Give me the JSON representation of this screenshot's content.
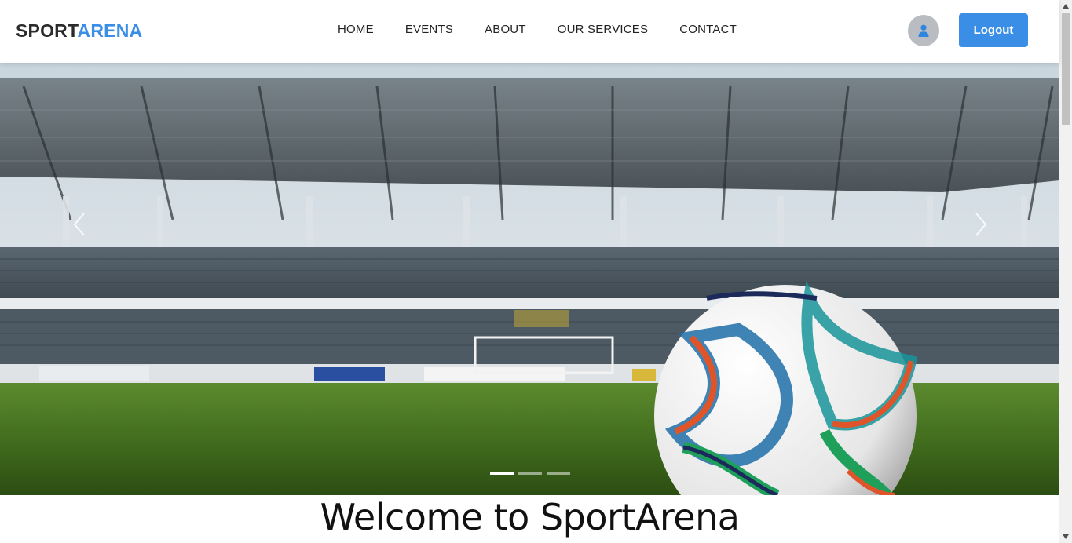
{
  "brand": {
    "part1": "SPORT",
    "part2": "ARENA"
  },
  "nav": {
    "items": [
      {
        "label": "HOME"
      },
      {
        "label": "EVENTS"
      },
      {
        "label": "ABOUT"
      },
      {
        "label": "OUR SERVICES"
      },
      {
        "label": "CONTACT"
      }
    ]
  },
  "header": {
    "avatar_icon": "user-icon",
    "logout_label": "Logout"
  },
  "carousel": {
    "image": "stadium-soccer-ball",
    "prev_icon": "chevron-left-icon",
    "next_icon": "chevron-right-icon",
    "slide_count": 3,
    "active_slide": 1
  },
  "welcome": {
    "heading": "Welcome to SportArena"
  },
  "colors": {
    "accent": "#3a8ee6",
    "avatar_bg": "#b9bcc0",
    "text": "#222222"
  }
}
